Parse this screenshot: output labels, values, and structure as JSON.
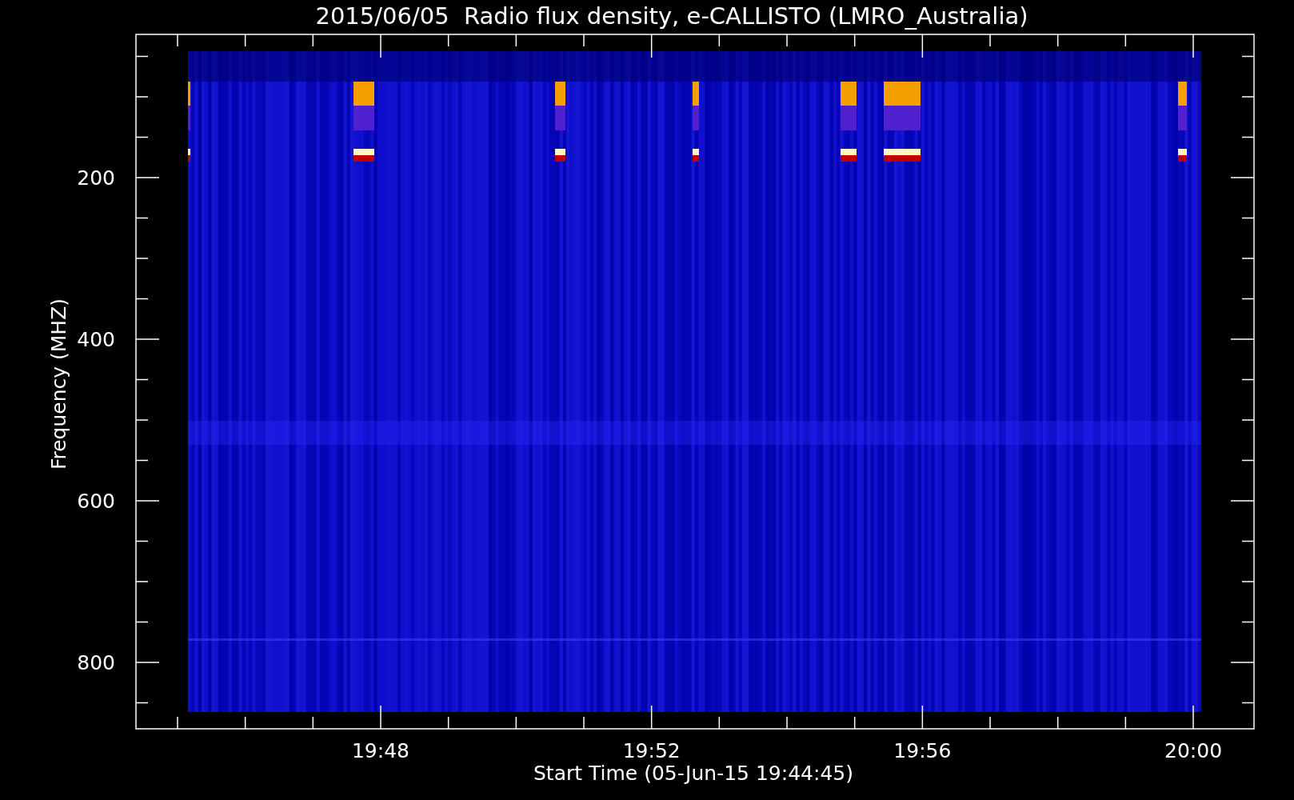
{
  "title": "2015/06/05  Radio flux density, e-CALLISTO (LMRO_Australia)",
  "y_axis": {
    "label": "Frequency (MHZ)",
    "ticks": [
      "200",
      "400",
      "600",
      "800"
    ]
  },
  "x_axis": {
    "label": "Start Time (05-Jun-15 19:44:45)",
    "ticks": [
      "19:48",
      "19:52",
      "19:56",
      "20:00"
    ]
  }
}
